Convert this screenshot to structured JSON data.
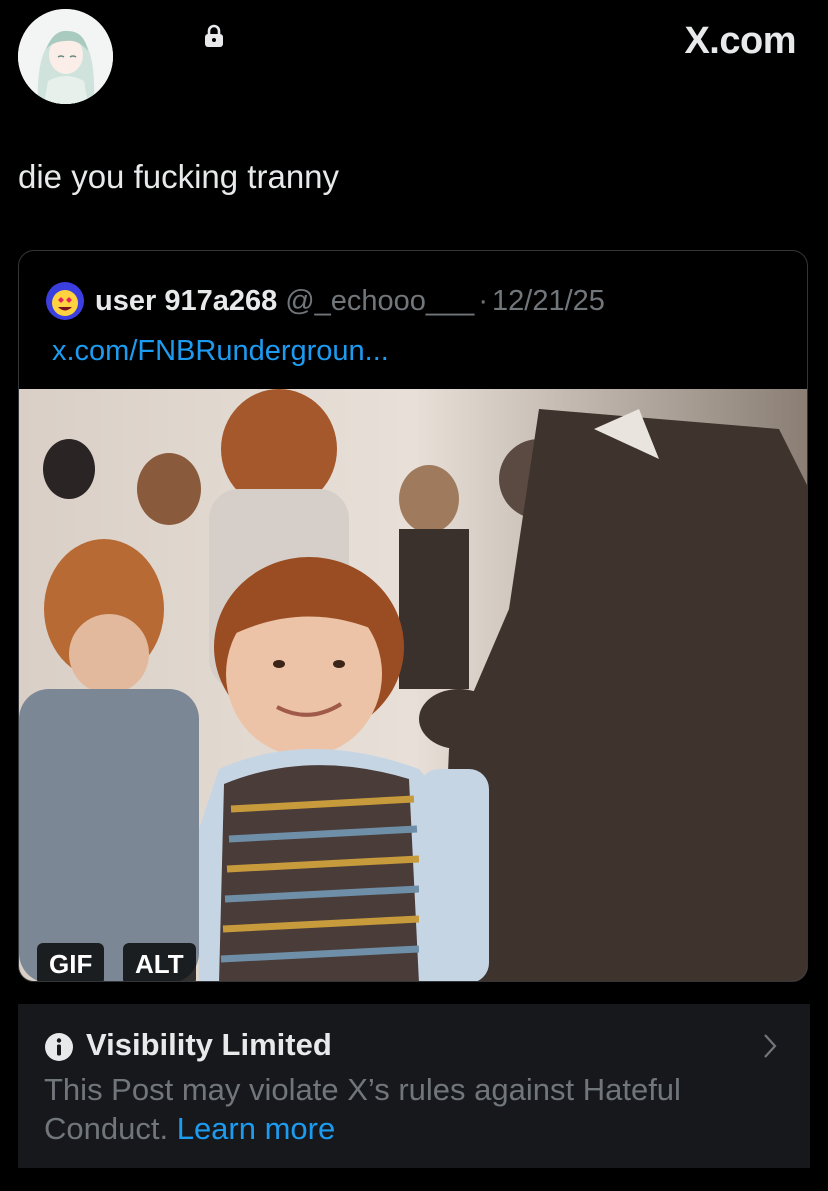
{
  "header": {
    "site_label": "X.com",
    "icons": [
      "avatar",
      "lock-icon"
    ]
  },
  "post": {
    "text": "die you fucking tranny"
  },
  "quoted_post": {
    "display_name": "user 917a268",
    "handle": "@_echooo___",
    "separator": "·",
    "date": "12/21/25",
    "link_text": "x.com/FNBRundergroun...",
    "media_badges": {
      "gif": "GIF",
      "alt": "ALT"
    }
  },
  "notice": {
    "title": "Visibility Limited",
    "body": "This Post may violate X’s rules against Hateful Conduct.",
    "link_text": "Learn more"
  },
  "colors": {
    "background": "#000000",
    "text": "#e7e9ea",
    "muted": "#71767b",
    "link": "#1d9bf0",
    "card": "#16181c"
  }
}
